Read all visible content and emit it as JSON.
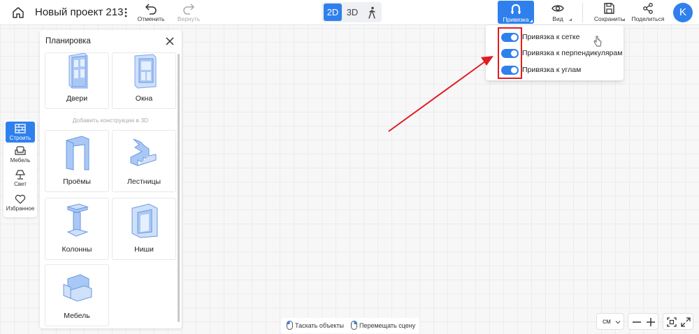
{
  "header": {
    "project_title": "Новый проект 213",
    "undo_label": "Отменить",
    "redo_label": "Вернуть",
    "view_modes": [
      "2D",
      "3D"
    ],
    "snap_label": "Привязка",
    "view_label": "Вид",
    "save_label": "Сохранить",
    "share_label": "Поделиться",
    "avatar_letter": "K"
  },
  "rail": {
    "items": [
      {
        "label": "Строить",
        "active": true,
        "icon": "brick-wall-icon"
      },
      {
        "label": "Мебель",
        "active": false,
        "icon": "sofa-icon"
      },
      {
        "label": "Свет",
        "active": false,
        "icon": "lamp-icon"
      },
      {
        "label": "Избранное",
        "active": false,
        "icon": "heart-icon"
      }
    ]
  },
  "panel": {
    "title": "Планировка",
    "section_3d_label": "Добавить конструкции в 3D",
    "items": [
      {
        "label": "Двери",
        "icon": "door-icon"
      },
      {
        "label": "Окна",
        "icon": "window-icon"
      },
      {
        "label": "Проёмы",
        "icon": "opening-icon"
      },
      {
        "label": "Лестницы",
        "icon": "stairs-icon"
      },
      {
        "label": "Колонны",
        "icon": "column-icon"
      },
      {
        "label": "Ниши",
        "icon": "niche-icon"
      },
      {
        "label": "Мебель",
        "icon": "armchair-icon"
      }
    ]
  },
  "snap_menu": {
    "options": [
      {
        "label": "Привязка к сетке",
        "on": true
      },
      {
        "label": "Привязка к перпендикулярам",
        "on": true
      },
      {
        "label": "Привязка к углам",
        "on": true
      }
    ]
  },
  "footer": {
    "drag_hint": "Таскать объекты",
    "pan_hint": "Перемещать сцену",
    "unit": "см"
  },
  "colors": {
    "accent": "#2f80ed",
    "annotation": "#e11b22",
    "icon_blue": "#a9c8f5"
  }
}
